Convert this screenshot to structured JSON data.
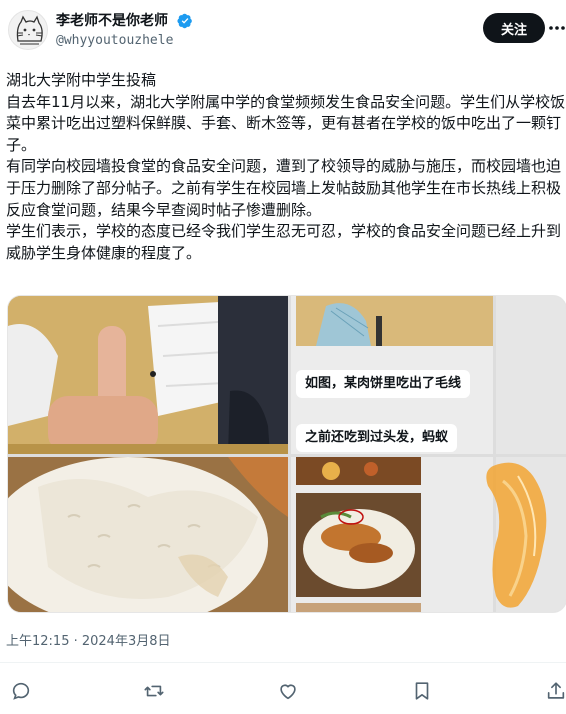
{
  "author": {
    "display_name": "李老师不是你老师",
    "handle": "@whyyoutouzhele",
    "verified": true
  },
  "header": {
    "follow_label": "关注",
    "more_icon": "more-icon"
  },
  "post": {
    "text": "湖北大学附中学生投稿\n自去年11月以来，湖北大学附属中学的食堂频频发生食品安全问题。学生们从学校饭菜中累计吃出过塑料保鲜膜、手套、断木签等，更有甚者在学校的饭中吃出了一颗钉子。\n有同学向校园墙投食堂的食品安全问题，遭到了校领导的威胁与施压，而校园墙也迫于压力删除了部分帖子。之前有学生在校园墙上发帖鼓励其他学生在市长热线上积极反应食堂问题，结果今早查阅时帖子惨遭删除。\n学生们表示，学校的态度已经令我们学生忍无可忍，学校的食品安全问题已经上升到威胁学生身体健康的程度了。",
    "media": {
      "chat_bubble_1": "如图，某肉饼里吃出了毛线",
      "chat_bubble_2": "之前还吃到过头发，蚂蚁"
    },
    "timestamp": "上午12:15 · 2024年3月8日"
  },
  "actions": [
    "reply-icon",
    "retweet-icon",
    "like-icon",
    "bookmark-icon",
    "share-icon"
  ],
  "colors": {
    "verified": "#1d9bf0",
    "follow_bg": "#0f1419",
    "secondary_text": "#536471"
  }
}
